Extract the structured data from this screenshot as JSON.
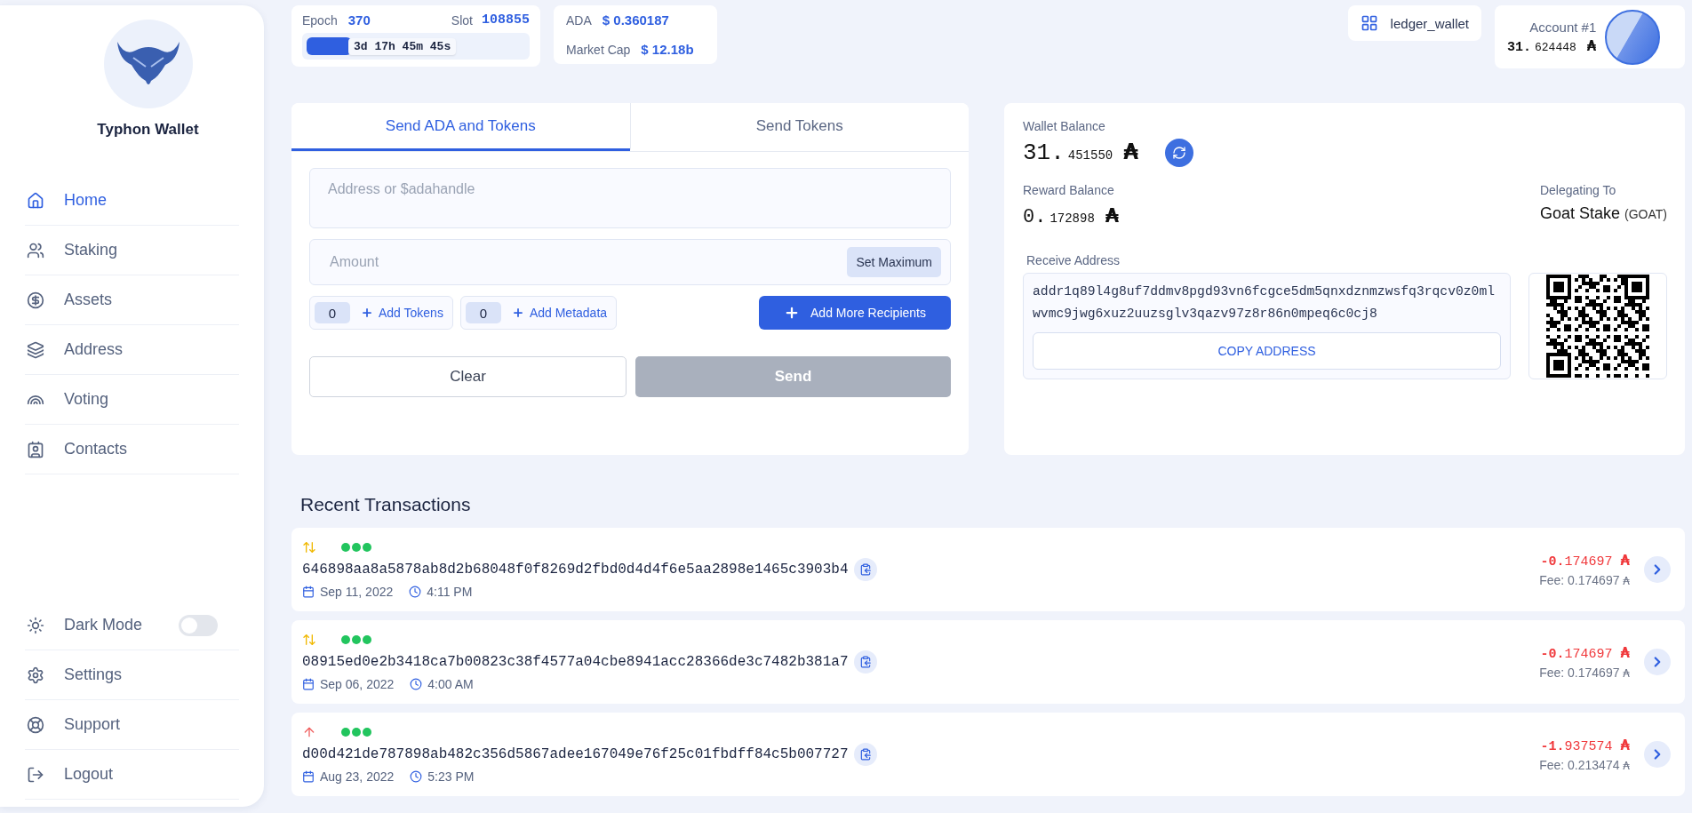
{
  "sidebar": {
    "brand": "Typhon Wallet",
    "nav": [
      {
        "label": "Home",
        "selected": true
      },
      {
        "label": "Staking",
        "selected": false
      },
      {
        "label": "Assets",
        "selected": false
      },
      {
        "label": "Address",
        "selected": false
      },
      {
        "label": "Voting",
        "selected": false
      },
      {
        "label": "Contacts",
        "selected": false
      }
    ],
    "footer": [
      {
        "kind": "toggle",
        "label": "Dark Mode",
        "on": false
      },
      {
        "kind": "link",
        "label": "Settings"
      },
      {
        "kind": "link",
        "label": "Support"
      },
      {
        "kind": "link",
        "label": "Logout"
      }
    ]
  },
  "epoch": {
    "epoch_label": "Epoch",
    "epoch": "370",
    "slot_label": "Slot",
    "slot": "108855",
    "level": 0.24,
    "remaining": "3d 17h 45m 45s"
  },
  "market": {
    "price_label": "ADA",
    "price": "$ 0.360187",
    "cap_label": "Market Cap",
    "cap": "$ 12.18b"
  },
  "wallet_chip": {
    "label": "ledger_wallet"
  },
  "account": {
    "name": "Account #1",
    "whole": "31.",
    "fraction": "624448",
    "unit": "₳"
  },
  "send": {
    "tabs": [
      {
        "label": "Send ADA and Tokens",
        "selected": true
      },
      {
        "label": "Send Tokens",
        "selected": false
      }
    ],
    "address": {
      "placeholder": "Address or $adahandle"
    },
    "amount": {
      "placeholder": "Amount"
    },
    "set_max": "Set Maximum",
    "tokens": {
      "count": "0",
      "label": "Add Tokens"
    },
    "metadata": {
      "count": "0",
      "label": "Add Metadata"
    },
    "add_recipients": "Add More Recipients",
    "clear": "Clear",
    "submit": {
      "label": "Send",
      "disabled": true
    }
  },
  "balance": {
    "wallet_label": "Wallet Balance",
    "wallet_whole": "31.",
    "wallet_fraction": "451550",
    "unit": "₳",
    "reward_label": "Reward Balance",
    "reward_whole": "0.",
    "reward_fraction": "172898",
    "delegating_label": "Delegating To",
    "pool_name": "Goat Stake",
    "pool_ticker": "(GOAT)",
    "receive_label": "Receive Address",
    "address": "addr1q89l4g8uf7ddmv8pgd93vn6fcgce5dm5qnxdznmzwsfq3rqcv0z0mlwvmc9jwg6xuz2uuzsglv3qazv97z8r86n0mpeq6c0cj8",
    "copy": "COPY ADDRESS"
  },
  "transactions": {
    "title": "Recent Transactions",
    "items": [
      {
        "kind": "swap",
        "hash": "646898aa8a5878ab8d2b68048f0f8269d2fbd0d4d4f6e5aa2898e1465c3903b4",
        "date": "Sep 11, 2022",
        "time": "4:11 PM",
        "amount_whole": "-0.",
        "amount_fraction": "174697",
        "unit": "₳",
        "fee": "Fee: 0.174697",
        "fee_unit": "₳"
      },
      {
        "kind": "swap",
        "hash": "08915ed0e2b3418ca7b00823c38f4577a04cbe8941acc28366de3c7482b381a7",
        "date": "Sep 06, 2022",
        "time": "4:00 AM",
        "amount_whole": "-0.",
        "amount_fraction": "174697",
        "unit": "₳",
        "fee": "Fee: 0.174697",
        "fee_unit": "₳"
      },
      {
        "kind": "send",
        "hash": "d00d421de787898ab482c356d5867adee167049e76f25c01fbdff84c5b007727",
        "date": "Aug 23, 2022",
        "time": "5:23 PM",
        "amount_whole": "-1.",
        "amount_fraction": "937574",
        "unit": "₳",
        "fee": "Fee: 0.213474",
        "fee_unit": "₳"
      }
    ]
  }
}
